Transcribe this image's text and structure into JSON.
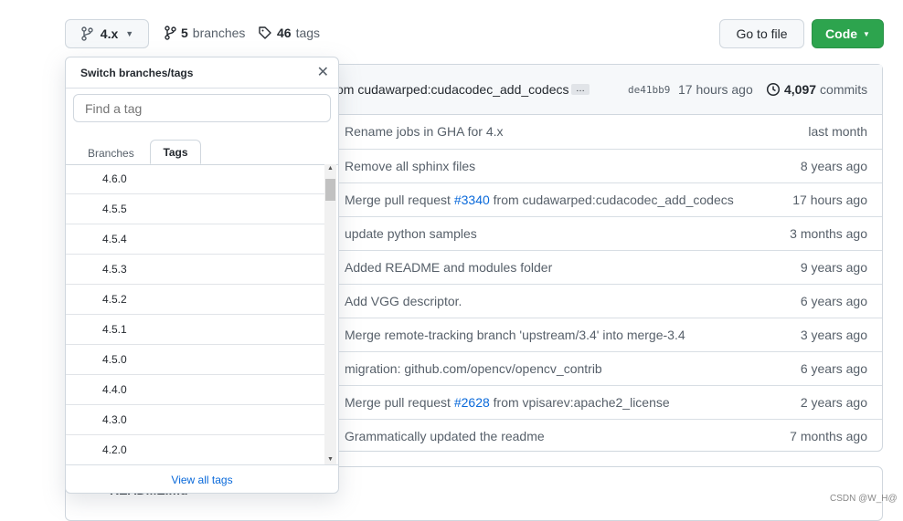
{
  "branch_button": {
    "label": "4.x"
  },
  "branches": {
    "count": "5",
    "label": "branches"
  },
  "tags": {
    "count": "46",
    "label": "tags"
  },
  "go_to_file": "Go to file",
  "code_button": "Code",
  "commit_header": {
    "message": "om cudawarped:cudacodec_add_codecs",
    "ellipsis": "…",
    "sha": "de41bb9",
    "time": "17 hours ago",
    "commits_count": "4,097",
    "commits_label": "commits"
  },
  "files": [
    {
      "message": "Rename jobs in GHA for 4.x",
      "age": "last month"
    },
    {
      "message": "Remove all sphinx files",
      "age": "8 years ago"
    },
    {
      "pre": "Merge pull request ",
      "link": "#3340",
      "post": " from cudawarped:cudacodec_add_codecs",
      "age": "17 hours ago"
    },
    {
      "message": "update python samples",
      "age": "3 months ago"
    },
    {
      "message": "Added README and modules folder",
      "age": "9 years ago"
    },
    {
      "message": "Add VGG descriptor.",
      "age": "6 years ago"
    },
    {
      "message": "Merge remote-tracking branch 'upstream/3.4' into merge-3.4",
      "age": "3 years ago"
    },
    {
      "message": "migration: github.com/opencv/opencv_contrib",
      "age": "6 years ago"
    },
    {
      "pre": "Merge pull request ",
      "link": "#2628",
      "post": " from vpisarev:apache2_license",
      "age": "2 years ago"
    },
    {
      "message": "Grammatically updated the readme",
      "age": "7 months ago"
    }
  ],
  "dropdown": {
    "title": "Switch branches/tags",
    "filter_placeholder": "Find a tag",
    "tabs": [
      "Branches",
      "Tags"
    ],
    "active_tab": "Tags",
    "items": [
      "4.6.0",
      "4.5.5",
      "4.5.4",
      "4.5.3",
      "4.5.2",
      "4.5.1",
      "4.5.0",
      "4.4.0",
      "4.3.0",
      "4.2.0"
    ],
    "footer": "View all tags"
  },
  "readme": {
    "title": "README.md"
  },
  "watermark": "CSDN @W_H@",
  "colors": {
    "accent": "#0969da",
    "primary": "#2da44e"
  }
}
